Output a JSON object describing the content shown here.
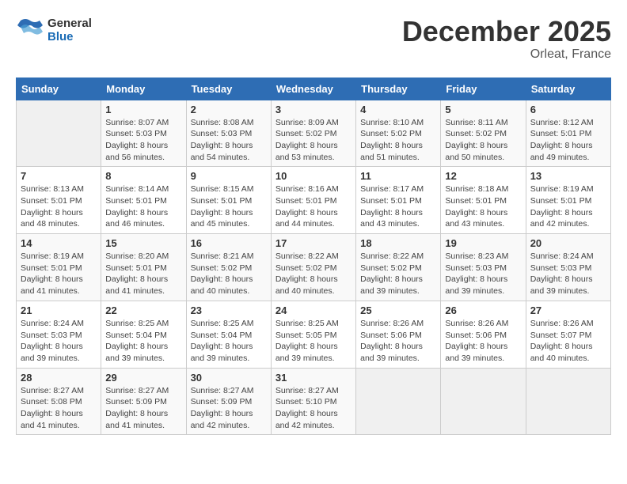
{
  "logo": {
    "line1": "General",
    "line2": "Blue"
  },
  "title": "December 2025",
  "subtitle": "Orleat, France",
  "days_of_week": [
    "Sunday",
    "Monday",
    "Tuesday",
    "Wednesday",
    "Thursday",
    "Friday",
    "Saturday"
  ],
  "weeks": [
    [
      {
        "day": "",
        "sunrise": "",
        "sunset": "",
        "daylight": ""
      },
      {
        "day": "1",
        "sunrise": "Sunrise: 8:07 AM",
        "sunset": "Sunset: 5:03 PM",
        "daylight": "Daylight: 8 hours and 56 minutes."
      },
      {
        "day": "2",
        "sunrise": "Sunrise: 8:08 AM",
        "sunset": "Sunset: 5:03 PM",
        "daylight": "Daylight: 8 hours and 54 minutes."
      },
      {
        "day": "3",
        "sunrise": "Sunrise: 8:09 AM",
        "sunset": "Sunset: 5:02 PM",
        "daylight": "Daylight: 8 hours and 53 minutes."
      },
      {
        "day": "4",
        "sunrise": "Sunrise: 8:10 AM",
        "sunset": "Sunset: 5:02 PM",
        "daylight": "Daylight: 8 hours and 51 minutes."
      },
      {
        "day": "5",
        "sunrise": "Sunrise: 8:11 AM",
        "sunset": "Sunset: 5:02 PM",
        "daylight": "Daylight: 8 hours and 50 minutes."
      },
      {
        "day": "6",
        "sunrise": "Sunrise: 8:12 AM",
        "sunset": "Sunset: 5:01 PM",
        "daylight": "Daylight: 8 hours and 49 minutes."
      }
    ],
    [
      {
        "day": "7",
        "sunrise": "Sunrise: 8:13 AM",
        "sunset": "Sunset: 5:01 PM",
        "daylight": "Daylight: 8 hours and 48 minutes."
      },
      {
        "day": "8",
        "sunrise": "Sunrise: 8:14 AM",
        "sunset": "Sunset: 5:01 PM",
        "daylight": "Daylight: 8 hours and 46 minutes."
      },
      {
        "day": "9",
        "sunrise": "Sunrise: 8:15 AM",
        "sunset": "Sunset: 5:01 PM",
        "daylight": "Daylight: 8 hours and 45 minutes."
      },
      {
        "day": "10",
        "sunrise": "Sunrise: 8:16 AM",
        "sunset": "Sunset: 5:01 PM",
        "daylight": "Daylight: 8 hours and 44 minutes."
      },
      {
        "day": "11",
        "sunrise": "Sunrise: 8:17 AM",
        "sunset": "Sunset: 5:01 PM",
        "daylight": "Daylight: 8 hours and 43 minutes."
      },
      {
        "day": "12",
        "sunrise": "Sunrise: 8:18 AM",
        "sunset": "Sunset: 5:01 PM",
        "daylight": "Daylight: 8 hours and 43 minutes."
      },
      {
        "day": "13",
        "sunrise": "Sunrise: 8:19 AM",
        "sunset": "Sunset: 5:01 PM",
        "daylight": "Daylight: 8 hours and 42 minutes."
      }
    ],
    [
      {
        "day": "14",
        "sunrise": "Sunrise: 8:19 AM",
        "sunset": "Sunset: 5:01 PM",
        "daylight": "Daylight: 8 hours and 41 minutes."
      },
      {
        "day": "15",
        "sunrise": "Sunrise: 8:20 AM",
        "sunset": "Sunset: 5:01 PM",
        "daylight": "Daylight: 8 hours and 41 minutes."
      },
      {
        "day": "16",
        "sunrise": "Sunrise: 8:21 AM",
        "sunset": "Sunset: 5:02 PM",
        "daylight": "Daylight: 8 hours and 40 minutes."
      },
      {
        "day": "17",
        "sunrise": "Sunrise: 8:22 AM",
        "sunset": "Sunset: 5:02 PM",
        "daylight": "Daylight: 8 hours and 40 minutes."
      },
      {
        "day": "18",
        "sunrise": "Sunrise: 8:22 AM",
        "sunset": "Sunset: 5:02 PM",
        "daylight": "Daylight: 8 hours and 39 minutes."
      },
      {
        "day": "19",
        "sunrise": "Sunrise: 8:23 AM",
        "sunset": "Sunset: 5:03 PM",
        "daylight": "Daylight: 8 hours and 39 minutes."
      },
      {
        "day": "20",
        "sunrise": "Sunrise: 8:24 AM",
        "sunset": "Sunset: 5:03 PM",
        "daylight": "Daylight: 8 hours and 39 minutes."
      }
    ],
    [
      {
        "day": "21",
        "sunrise": "Sunrise: 8:24 AM",
        "sunset": "Sunset: 5:03 PM",
        "daylight": "Daylight: 8 hours and 39 minutes."
      },
      {
        "day": "22",
        "sunrise": "Sunrise: 8:25 AM",
        "sunset": "Sunset: 5:04 PM",
        "daylight": "Daylight: 8 hours and 39 minutes."
      },
      {
        "day": "23",
        "sunrise": "Sunrise: 8:25 AM",
        "sunset": "Sunset: 5:04 PM",
        "daylight": "Daylight: 8 hours and 39 minutes."
      },
      {
        "day": "24",
        "sunrise": "Sunrise: 8:25 AM",
        "sunset": "Sunset: 5:05 PM",
        "daylight": "Daylight: 8 hours and 39 minutes."
      },
      {
        "day": "25",
        "sunrise": "Sunrise: 8:26 AM",
        "sunset": "Sunset: 5:06 PM",
        "daylight": "Daylight: 8 hours and 39 minutes."
      },
      {
        "day": "26",
        "sunrise": "Sunrise: 8:26 AM",
        "sunset": "Sunset: 5:06 PM",
        "daylight": "Daylight: 8 hours and 39 minutes."
      },
      {
        "day": "27",
        "sunrise": "Sunrise: 8:26 AM",
        "sunset": "Sunset: 5:07 PM",
        "daylight": "Daylight: 8 hours and 40 minutes."
      }
    ],
    [
      {
        "day": "28",
        "sunrise": "Sunrise: 8:27 AM",
        "sunset": "Sunset: 5:08 PM",
        "daylight": "Daylight: 8 hours and 41 minutes."
      },
      {
        "day": "29",
        "sunrise": "Sunrise: 8:27 AM",
        "sunset": "Sunset: 5:09 PM",
        "daylight": "Daylight: 8 hours and 41 minutes."
      },
      {
        "day": "30",
        "sunrise": "Sunrise: 8:27 AM",
        "sunset": "Sunset: 5:09 PM",
        "daylight": "Daylight: 8 hours and 42 minutes."
      },
      {
        "day": "31",
        "sunrise": "Sunrise: 8:27 AM",
        "sunset": "Sunset: 5:10 PM",
        "daylight": "Daylight: 8 hours and 42 minutes."
      },
      {
        "day": "",
        "sunrise": "",
        "sunset": "",
        "daylight": ""
      },
      {
        "day": "",
        "sunrise": "",
        "sunset": "",
        "daylight": ""
      },
      {
        "day": "",
        "sunrise": "",
        "sunset": "",
        "daylight": ""
      }
    ]
  ]
}
